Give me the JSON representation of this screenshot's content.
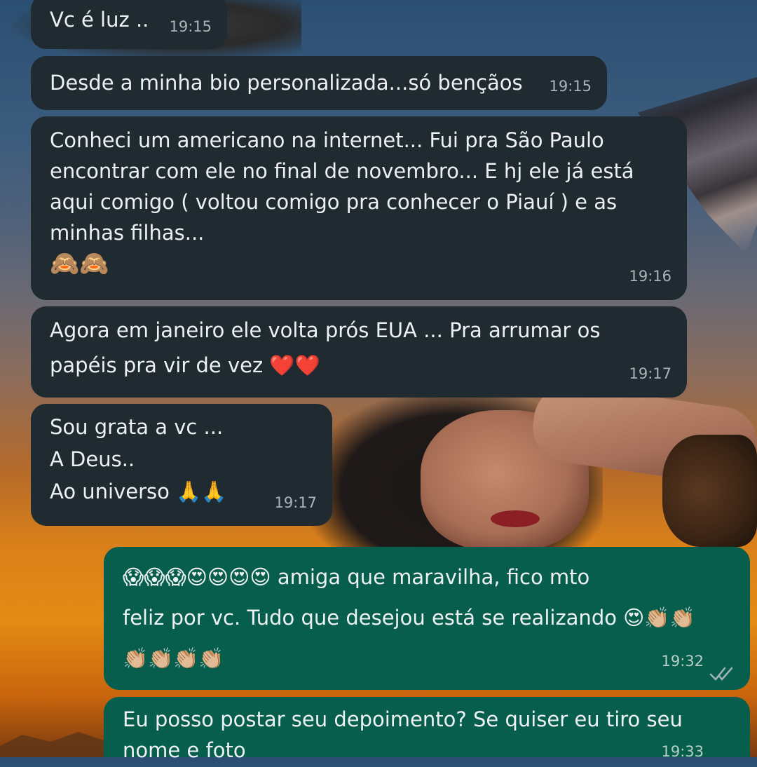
{
  "messages": [
    {
      "direction": "incoming",
      "lines": [
        "Vc é luz .."
      ],
      "time": "19:15"
    },
    {
      "direction": "incoming",
      "lines": [
        "Desde a minha bio personalizada...só bençãos"
      ],
      "time": "19:15"
    },
    {
      "direction": "incoming",
      "lines": [
        "Conheci um americano na internet... Fui pra São Paulo",
        "encontrar com ele no final de novembro... E hj ele já está",
        "aqui comigo ( voltou comigo pra conhecer o Piauí ) e as",
        "minhas filhas...",
        "🙈🙈"
      ],
      "time": "19:16"
    },
    {
      "direction": "incoming",
      "lines": [
        "Agora em janeiro ele volta prós EUA ... Pra arrumar os",
        "papéis pra vir de vez ❤️❤️"
      ],
      "time": "19:17"
    },
    {
      "direction": "incoming",
      "lines": [
        "Sou grata a vc ...",
        "A Deus..",
        "Ao universo 🙏🙏"
      ],
      "time": "19:17"
    },
    {
      "direction": "outgoing",
      "lines": [
        "😱😱😱😍😍😍😍 amiga que maravilha, fico mto",
        "feliz por vc. Tudo que desejou está se realizando 😍👏🏼👏🏼",
        "👏🏼👏🏼👏🏼👏🏼"
      ],
      "time": "19:32",
      "status": "read"
    },
    {
      "direction": "outgoing",
      "lines": [
        "Eu posso postar seu depoimento? Se quiser eu tiro seu",
        "nome e foto"
      ],
      "time": "19:33"
    }
  ],
  "colors": {
    "incoming_bubble": "#1f2a31",
    "outgoing_bubble": "#075e4c",
    "read_ticks": "#9fb4bb"
  }
}
